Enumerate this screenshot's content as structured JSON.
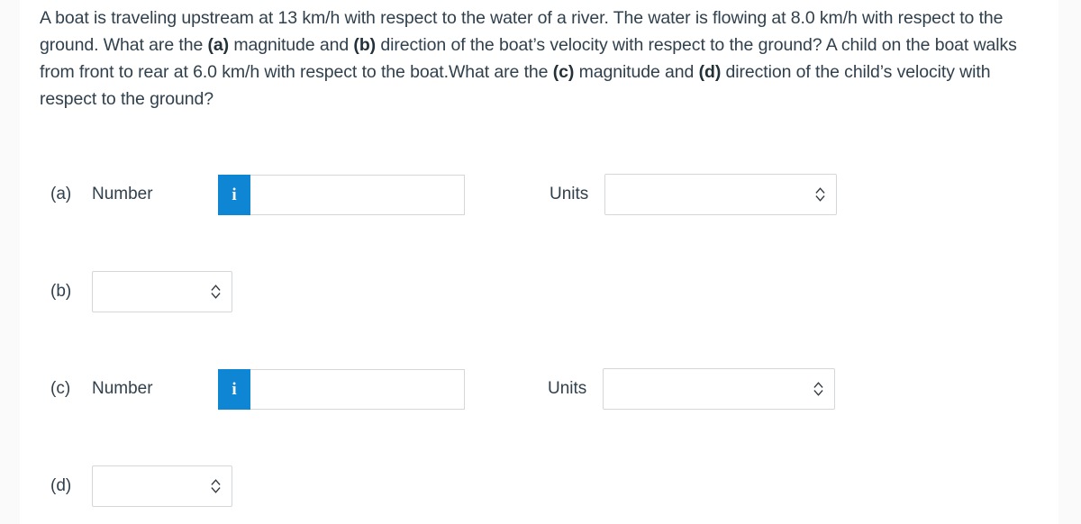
{
  "question": {
    "segments": [
      {
        "text": "A boat is traveling upstream at 13 km/h with respect to the water of a river. The water is flowing at 8.0 km/h with respect to the ground. What are the ",
        "bold": false
      },
      {
        "text": "(a)",
        "bold": true
      },
      {
        "text": " magnitude and ",
        "bold": false
      },
      {
        "text": "(b)",
        "bold": true
      },
      {
        "text": " direction of the boat’s velocity with respect to the ground? A child on the boat walks from front to rear at 6.0 km/h with respect to the boat.What are the ",
        "bold": false
      },
      {
        "text": "(c)",
        "bold": true
      },
      {
        "text": " magnitude and ",
        "bold": false
      },
      {
        "text": "(d)",
        "bold": true
      },
      {
        "text": " direction of the child’s velocity with respect to the ground?",
        "bold": false
      }
    ],
    "plain": "A boat is traveling upstream at 13 km/h with respect to the water of a river. The water is flowing at 8.0 km/h with respect to the ground. What are the (a) magnitude and (b) direction of the boat’s velocity with respect to the ground? A child on the boat walks from front to rear at 6.0 km/h with respect to the boat.What are the (c) magnitude and (d) direction of the child’s velocity with respect to the ground?"
  },
  "rows": {
    "a": {
      "part_label": "(a)",
      "number_label": "Number",
      "info_icon": "i",
      "number_value": "",
      "number_placeholder": "",
      "units_label": "Units",
      "units_value": "",
      "units_chevron_icon": "chevron-up-down-icon"
    },
    "b": {
      "part_label": "(b)",
      "direction_value": "",
      "direction_chevron_icon": "chevron-up-down-icon"
    },
    "c": {
      "part_label": "(c)",
      "number_label": "Number",
      "info_icon": "i",
      "number_value": "",
      "number_placeholder": "",
      "units_label": "Units",
      "units_value": "",
      "units_chevron_icon": "chevron-up-down-icon"
    },
    "d": {
      "part_label": "(d)",
      "direction_value": "",
      "direction_chevron_icon": "chevron-up-down-icon"
    }
  },
  "colors": {
    "info_button_blue": "#0f86d4",
    "text": "#30404d",
    "field_border": "#d4d7da",
    "page_background": "#fafafa",
    "card_background": "#ffffff"
  }
}
